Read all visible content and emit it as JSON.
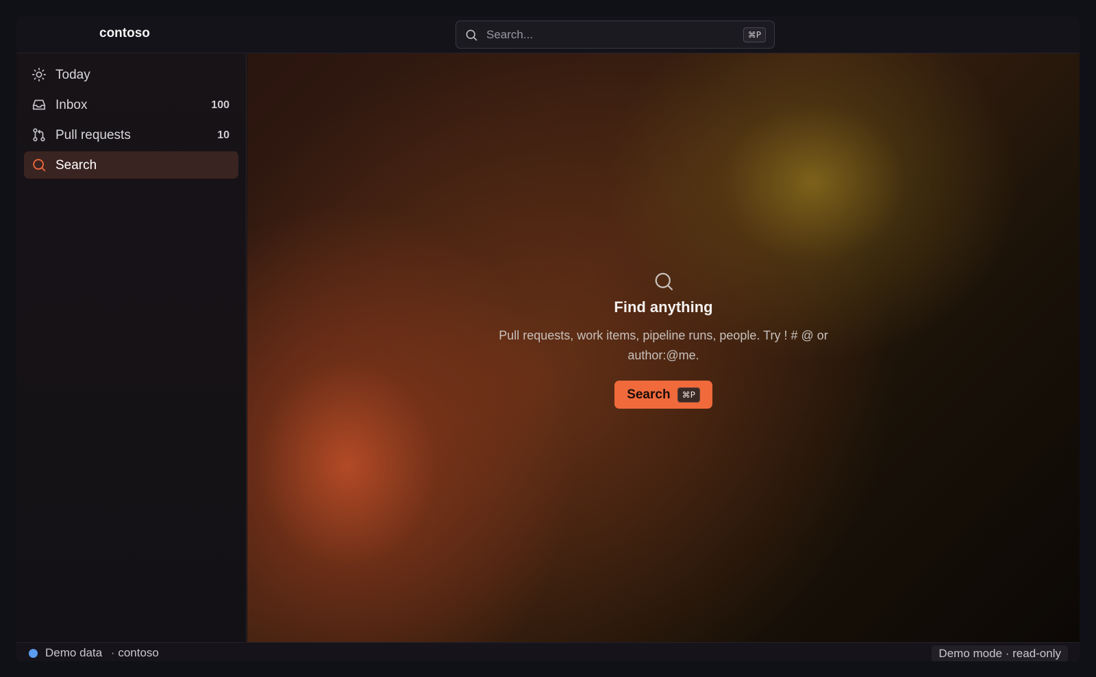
{
  "app": {
    "brand": "contoso",
    "accent_color": "#f06a3c"
  },
  "search": {
    "placeholder": "Search...",
    "shortcut": "⌘P"
  },
  "sidebar": {
    "items": [
      {
        "label": "Today",
        "icon": "sun-icon",
        "count": ""
      },
      {
        "label": "Inbox",
        "icon": "inbox-icon",
        "count": "100"
      },
      {
        "label": "Pull requests",
        "icon": "git-pull-request-icon",
        "count": "10"
      },
      {
        "label": "Search",
        "icon": "search-icon",
        "count": "",
        "active": true
      }
    ]
  },
  "main": {
    "empty_state": {
      "icon": "search-icon",
      "title": "Find anything",
      "description": "Pull requests, work items, pipeline runs, people. Try ! # @ or author:@me.",
      "button_label": "Search",
      "button_shortcut": "⌘P"
    }
  },
  "statusbar": {
    "indicator_color": "#5b9cf0",
    "data_label": "Demo data",
    "separator": "·",
    "org": "contoso",
    "mode": "Demo mode · read-only"
  }
}
